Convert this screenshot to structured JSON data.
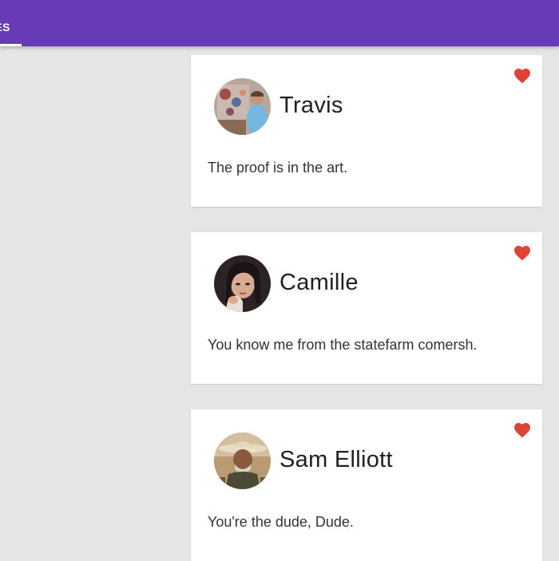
{
  "header": {
    "tab_label": "ES",
    "bar_color": "#673ab7"
  },
  "cards": [
    {
      "name": "Travis",
      "bio": "The proof is in the art.",
      "avatar_icon": "avatar-photo",
      "favorite_icon": "heart-icon",
      "favorited": true
    },
    {
      "name": "Camille",
      "bio": "You know me from the statefarm comersh.",
      "avatar_icon": "avatar-photo",
      "favorite_icon": "heart-icon",
      "favorited": true
    },
    {
      "name": "Sam Elliott",
      "bio": "You're the dude, Dude.",
      "avatar_icon": "avatar-photo",
      "favorite_icon": "heart-icon",
      "favorited": true
    }
  ],
  "colors": {
    "background": "#e5e5e5",
    "card": "#ffffff",
    "heart": "#db4437"
  }
}
